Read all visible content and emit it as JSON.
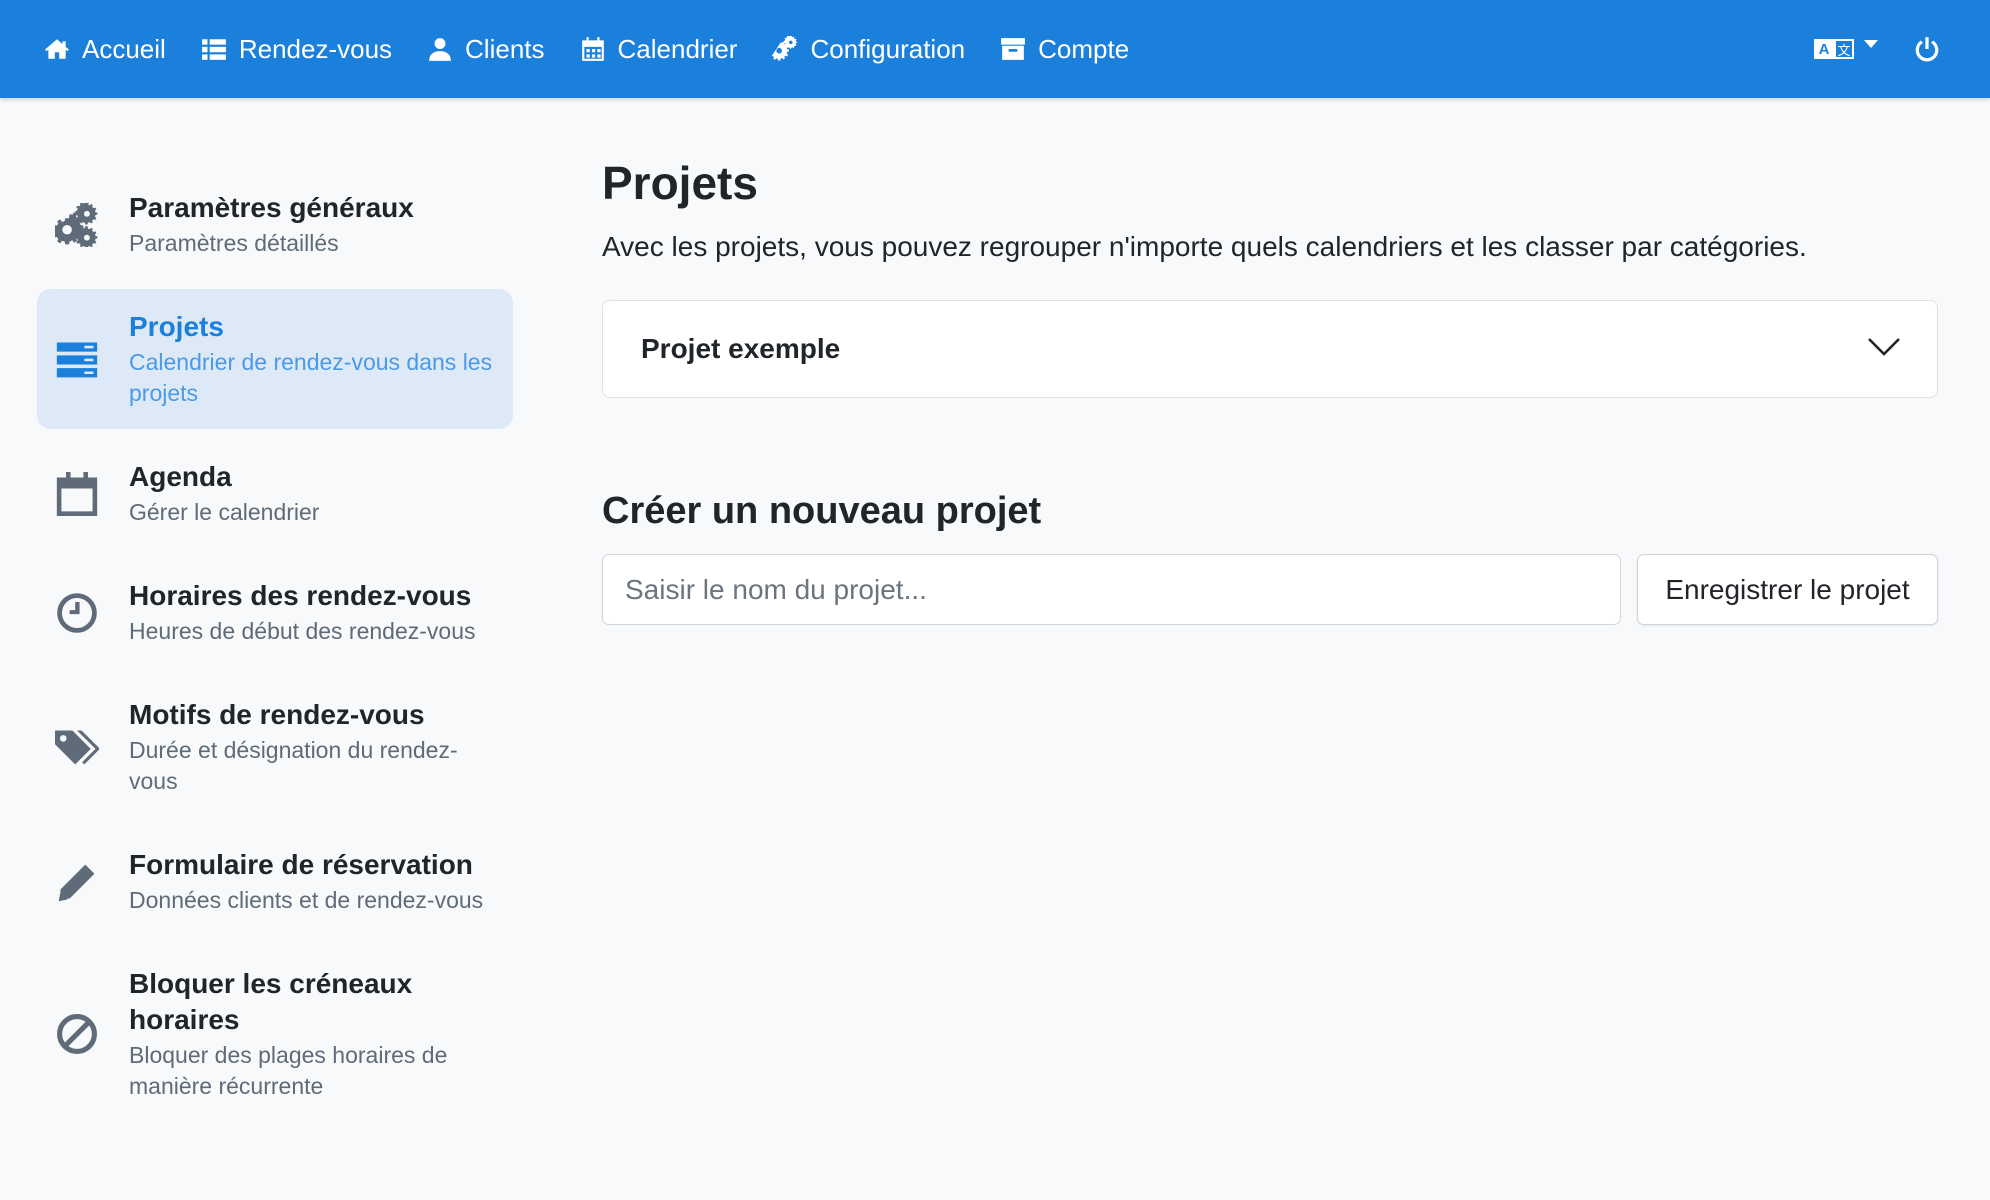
{
  "nav": {
    "items": [
      {
        "label": "Accueil",
        "icon": "home-icon"
      },
      {
        "label": "Rendez-vous",
        "icon": "list-icon"
      },
      {
        "label": "Clients",
        "icon": "user-icon"
      },
      {
        "label": "Calendrier",
        "icon": "calendar-icon"
      },
      {
        "label": "Configuration",
        "icon": "gears-icon"
      },
      {
        "label": "Compte",
        "icon": "archive-icon"
      }
    ],
    "lang_a": "A",
    "lang_b": "文",
    "power_icon": "power-icon"
  },
  "sidebar": {
    "items": [
      {
        "title": "Paramètres généraux",
        "sub": "Paramètres détaillés",
        "icon": "gears-icon",
        "active": false
      },
      {
        "title": "Projets",
        "sub": "Calendrier de rendez-vous dans les projets",
        "icon": "server-icon",
        "active": true
      },
      {
        "title": "Agenda",
        "sub": "Gérer le calendrier",
        "icon": "calendar-outline-icon",
        "active": false
      },
      {
        "title": "Horaires des rendez-vous",
        "sub": "Heures de début des rendez-vous",
        "icon": "clock-icon",
        "active": false
      },
      {
        "title": "Motifs de rendez-vous",
        "sub": "Durée et désignation du rendez-vous",
        "icon": "tags-icon",
        "active": false
      },
      {
        "title": "Formulaire de réservation",
        "sub": "Données clients et de rendez-vous",
        "icon": "pencil-icon",
        "active": false
      },
      {
        "title": "Bloquer les créneaux horaires",
        "sub": "Bloquer des plages horaires de manière récurrente",
        "icon": "ban-icon",
        "active": false
      }
    ]
  },
  "main": {
    "title": "Projets",
    "description": "Avec les projets, vous pouvez regrouper n'importe quels calendriers et les classer par catégories.",
    "project": "Projet exemple",
    "create_title": "Créer un nouveau projet",
    "input_placeholder": "Saisir le nom du projet...",
    "input_value": "",
    "save_label": "Enregistrer le projet"
  },
  "colors": {
    "primary": "#1b80dc",
    "active_bg": "#dde9f6",
    "icon_gray": "#5f6b78"
  }
}
